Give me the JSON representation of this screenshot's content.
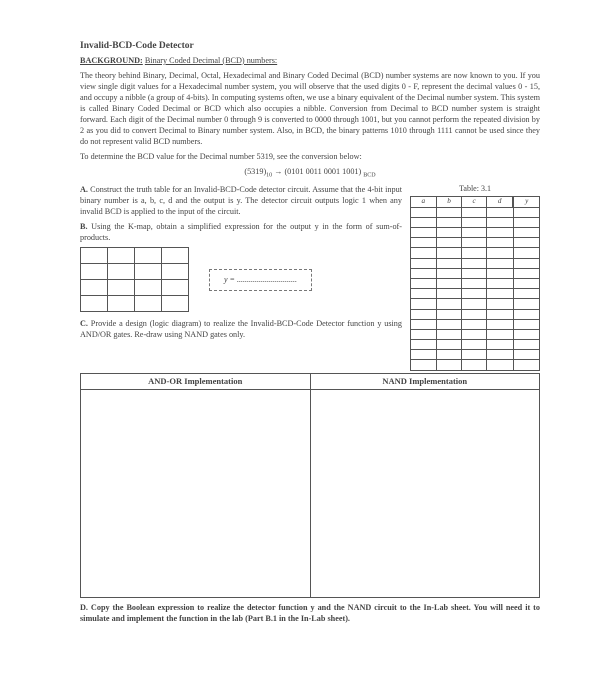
{
  "title": "Invalid-BCD-Code Detector",
  "bg_label": "BACKGROUND:",
  "bg_sub": "Binary Coded Decimal (BCD) numbers:",
  "para1": "The theory behind Binary, Decimal, Octal, Hexadecimal and Binary Coded Decimal (BCD) number systems are now known to you. If you view single digit values for a Hexadecimal number system, you will observe that the used digits 0 - F, represent the decimal values 0 - 15, and occupy a nibble (a group of 4-bits). In computing systems often, we use a binary equivalent of the Decimal number system. This system is called Binary Coded Decimal or BCD which also occupies a nibble. Conversion from Decimal to BCD number system is straight forward. Each digit of the Decimal number 0 through 9 is converted to 0000 through 1001, but you cannot perform the repeated division by 2 as you did to convert Decimal to Binary number system. Also, in BCD, the binary patterns 1010 through 1111 cannot be used since they do not represent valid BCD numbers.",
  "para2": "To determine the BCD value for the Decimal number 5319, see the conversion below:",
  "conv_left": "(5319)",
  "conv_sub1": "10",
  "conv_arrow": "→",
  "conv_right": "(0101 0011 0001 1001)",
  "conv_sub2": "BCD",
  "secA_label": "A.",
  "secA_text": " Construct the truth table for an Invalid-BCD-Code detector circuit. Assume that the 4-bit input binary number is a, b, c, d and the output is y. The detector circuit outputs logic 1 when any invalid BCD is applied to the input of the circuit.",
  "truth_title": "Table: 3.1",
  "truth_headers": [
    "a",
    "b",
    "c",
    "d",
    "y"
  ],
  "secB_label": "B.",
  "secB_text": " Using the K-map, obtain a simplified expression for the output y in the form of sum-of-products.",
  "y_label": "y = ",
  "y_dots": "..............................",
  "secC_label": "C.",
  "secC_text": " Provide a design (logic diagram) to realize the Invalid-BCD-Code Detector function y using AND/OR gates. Re-draw using NAND gates only.",
  "impl_h1": "AND-OR Implementation",
  "impl_h2": "NAND Implementation",
  "secD": "D. Copy the Boolean expression to realize the detector function y and the NAND circuit to the In-Lab sheet. You will need it to simulate and implement the function in the lab (Part B.1 in the In-Lab sheet)."
}
